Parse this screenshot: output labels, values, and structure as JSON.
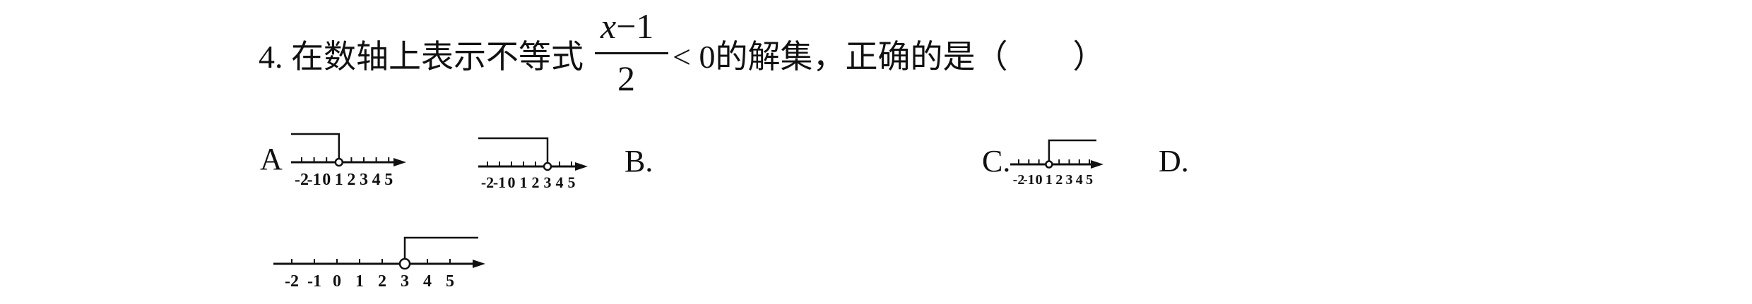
{
  "question": {
    "number": "4.",
    "prefix": "在数轴上表示不等式",
    "numerator_var": "x",
    "numerator_rest": "−1",
    "denominator": "2",
    "relation": "< 0",
    "suffix": "的解集，正确的是（　　）"
  },
  "options": [
    {
      "label": "A",
      "ticks": [
        "-2",
        "-1",
        "0",
        "1",
        "2",
        "3",
        "4",
        "5"
      ],
      "open_point": "1",
      "direction": "left"
    },
    {
      "label": "B.",
      "ticks": [
        "-2",
        "-1",
        "0",
        "1",
        "2",
        "3",
        "4",
        "5"
      ],
      "open_point": "3",
      "direction": "left"
    },
    {
      "label": "C.",
      "ticks": [
        "-2",
        "-1",
        "0",
        "1",
        "2",
        "3",
        "4",
        "5"
      ],
      "open_point": "1",
      "direction": "right"
    },
    {
      "label": "D.",
      "ticks": [
        "-2",
        "-1",
        "0",
        "1",
        "2",
        "3",
        "4",
        "5"
      ],
      "open_point": "3",
      "direction": "right"
    }
  ]
}
